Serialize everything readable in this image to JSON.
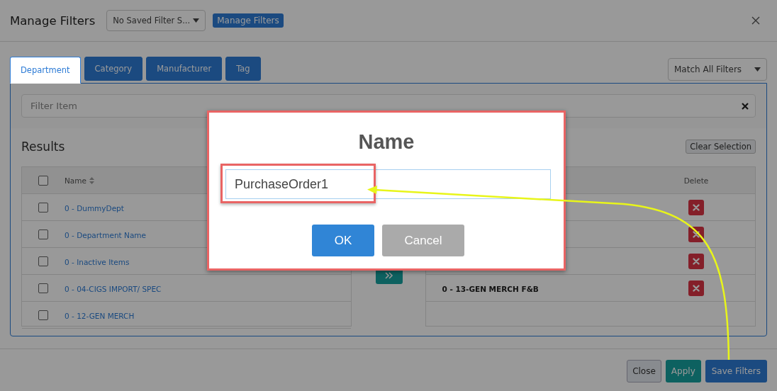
{
  "modal": {
    "title": "Manage Filters",
    "saved_filter_select": {
      "value": "No Saved Filter S..."
    },
    "manage_button": "Manage Filters"
  },
  "tabs": [
    {
      "label": "Department",
      "selected": true
    },
    {
      "label": "Category",
      "selected": false
    },
    {
      "label": "Manufacturer",
      "selected": false
    },
    {
      "label": "Tag",
      "selected": false
    }
  ],
  "match_select": {
    "value": "Match All Filters"
  },
  "filter_field": {
    "placeholder": "Filter Item"
  },
  "results": {
    "title": "Results",
    "clear_button": "Clear Selection"
  },
  "left_table": {
    "select_all": {
      "checked": false
    },
    "columns": [
      "Name"
    ],
    "rows": [
      {
        "name": "0 - DummyDept",
        "checked": false
      },
      {
        "name": "0 - Department Name",
        "checked": false
      },
      {
        "name": "0 - Inactive Items",
        "checked": false
      },
      {
        "name": "0 - 04-CIGS IMPORT/ SPEC",
        "checked": false
      },
      {
        "name": "0 - 12-GEN MERCH",
        "checked": false
      }
    ]
  },
  "right_table": {
    "columns": [
      "Delete"
    ],
    "rows": [
      {
        "kind": "hidden"
      },
      {
        "kind": "hidden"
      },
      {
        "kind": "hidden"
      },
      {
        "kind": "named",
        "name": "0 - 13-GEN MERCH F&B"
      }
    ]
  },
  "footer_buttons": [
    {
      "label": "Close",
      "kind": "secondary"
    },
    {
      "label": "Apply",
      "kind": "success"
    },
    {
      "label": "Save Filters",
      "kind": "primary"
    }
  ],
  "dialog": {
    "title": "Name",
    "value": "PurchaseOrder1",
    "buttons": [
      {
        "label": "OK",
        "kind": "confirm"
      },
      {
        "label": "Cancel",
        "kind": "cancel"
      }
    ]
  }
}
